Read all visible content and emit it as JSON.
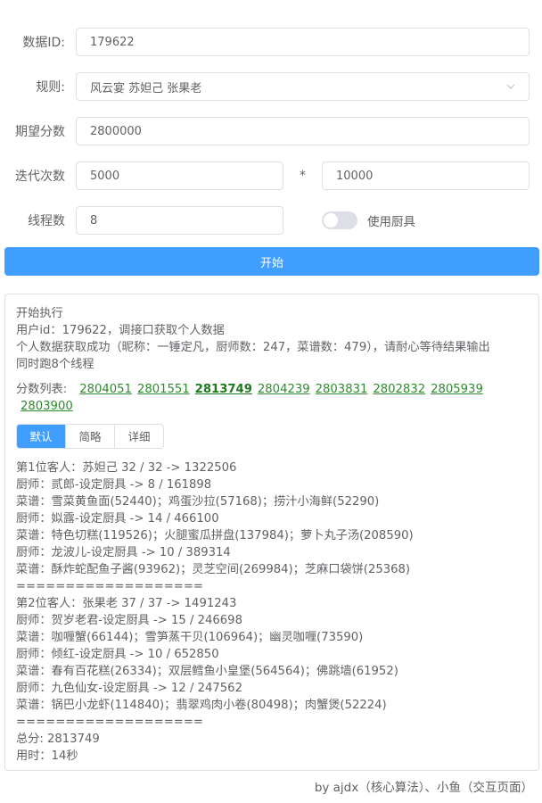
{
  "form": {
    "id_label": "数据ID:",
    "id_value": "179622",
    "rule_label": "规则:",
    "rule_value": "风云宴 苏妲己 张果老",
    "expect_label": "期望分数",
    "expect_value": "2800000",
    "iter_label": "迭代次数",
    "iter_value_a": "5000",
    "iter_mult": "*",
    "iter_value_b": "10000",
    "thread_label": "线程数",
    "thread_value": "8",
    "use_tools_label": "使用厨具",
    "use_tools_on": false
  },
  "start_button": "开始",
  "log": {
    "header_lines": [
      "开始执行",
      "用户id：179622，调接口获取个人数据",
      "个人数据获取成功（昵称：一锤定凡，厨师数：247，菜谱数：479），请耐心等待结果输出",
      "同时跑8个线程"
    ],
    "scores_label": "分数列表:",
    "scores": [
      "2804051",
      "2801551",
      "2813749",
      "2804239",
      "2803831",
      "2802832",
      "2805939",
      "2803900"
    ],
    "best_score_index": 2,
    "tabs": [
      "默认",
      "简略",
      "详细"
    ],
    "active_tab": 0,
    "detail_lines": [
      "第1位客人：苏妲己 32 / 32 -> 1322506",
      "厨师：贰郎-设定厨具 -> 8 / 161898",
      "菜谱：雪菜黄鱼面(52440)；鸡蛋沙拉(57168)；捞汁小海鲜(52290)",
      "厨师：姒露-设定厨具 -> 14 / 466100",
      "菜谱：特色切糕(119526)；火腿蜜瓜拼盘(137984)；萝卜丸子汤(208590)",
      "厨师：龙波儿-设定厨具 -> 10 / 389314",
      "菜谱：酥炸蛇配鱼子酱(93962)；灵芝空间(269984)；芝麻口袋饼(25368)",
      "===================",
      "第2位客人：张果老 37 / 37 -> 1491243",
      "厨师：贺岁老君-设定厨具 -> 15 / 246698",
      "菜谱：咖喱蟹(66144)；雪笋蒸干贝(106964)；幽灵咖喱(73590)",
      "厨师：倾红-设定厨具 -> 10 / 652850",
      "菜谱：春有百花糕(26334)；双层鳕鱼小皇堡(564564)；佛跳墙(61952)",
      "厨师：九色仙女-设定厨具 -> 12 / 247562",
      "菜谱：锅巴小龙虾(114840)；翡翠鸡肉小卷(80498)；肉蟹煲(52224)",
      "===================",
      "总分: 2813749",
      "用时：14秒"
    ]
  },
  "footer": "by ajdx（核心算法）、小鱼（交互页面）",
  "colors": {
    "primary": "#409eff",
    "score_link": "#2e8b2e",
    "border": "#dcdfe6"
  }
}
